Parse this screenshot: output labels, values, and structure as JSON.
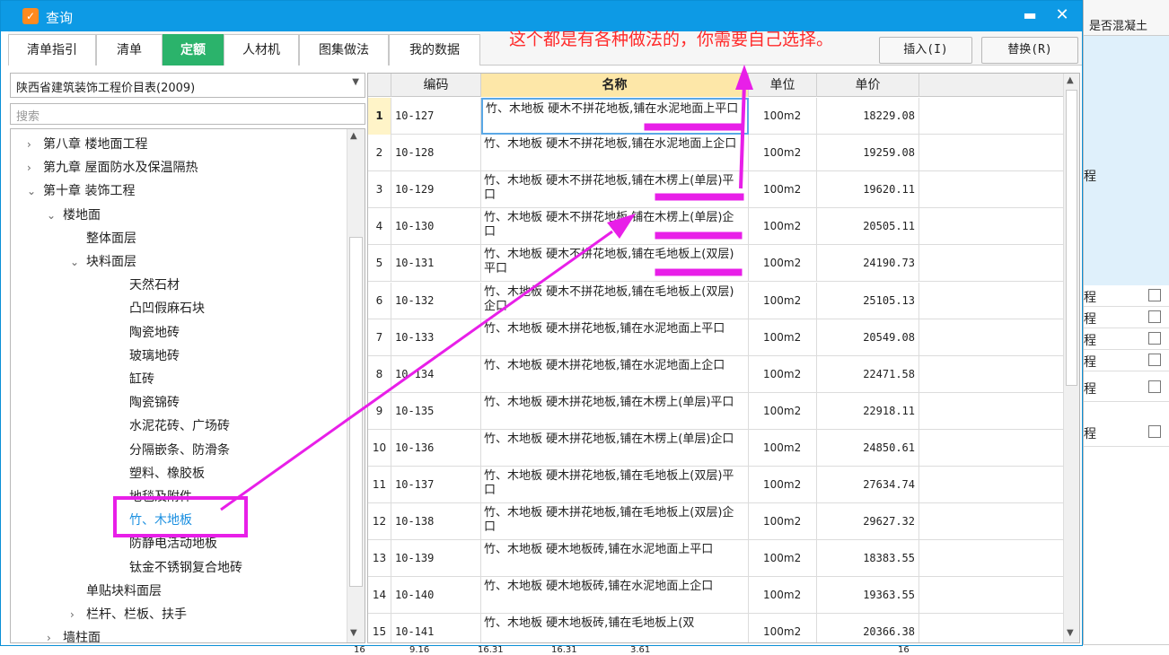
{
  "background": {
    "right_header": "是否混凝土",
    "right_label": "程",
    "rows": [
      "程",
      "程",
      "程",
      "程",
      "程",
      "程"
    ],
    "bottom_numbers": [
      "16",
      "9.16",
      "16.31",
      "16.31",
      "3.61",
      "16"
    ]
  },
  "dialog": {
    "title": "查询",
    "icon": "app-logo-icon",
    "minimize_label": "▬",
    "close_label": "✕"
  },
  "tabs": [
    {
      "label": "清单指引"
    },
    {
      "label": "清单"
    },
    {
      "label": "定额",
      "active": true
    },
    {
      "label": "人材机"
    },
    {
      "label": "图集做法"
    },
    {
      "label": "我的数据"
    }
  ],
  "annotation_text": "这个都是有各种做法的，你需要自己选择。",
  "actions": {
    "insert_label": "插入(I)",
    "replace_label": "替换(R)"
  },
  "library": {
    "selected": "陕西省建筑装饰工程价目表(2009)",
    "search_placeholder": "搜索"
  },
  "tree": [
    {
      "label": "第八章 楼地面工程",
      "chev": "›",
      "level": 1
    },
    {
      "label": "第九章 屋面防水及保温隔热",
      "chev": "›",
      "level": 1
    },
    {
      "label": "第十章 装饰工程",
      "chev": "⌄",
      "level": 1
    },
    {
      "label": "楼地面",
      "chev": "⌄",
      "level": 2
    },
    {
      "label": "整体面层",
      "chev": "",
      "level": 3
    },
    {
      "label": "块料面层",
      "chev": "⌄",
      "level": 3
    },
    {
      "label": "天然石材",
      "chev": "",
      "level": 4
    },
    {
      "label": "凸凹假麻石块",
      "chev": "",
      "level": 4
    },
    {
      "label": "陶瓷地砖",
      "chev": "",
      "level": 4
    },
    {
      "label": "玻璃地砖",
      "chev": "",
      "level": 4
    },
    {
      "label": "缸砖",
      "chev": "",
      "level": 4
    },
    {
      "label": "陶瓷锦砖",
      "chev": "",
      "level": 4
    },
    {
      "label": "水泥花砖、广场砖",
      "chev": "",
      "level": 4
    },
    {
      "label": "分隔嵌条、防滑条",
      "chev": "",
      "level": 4
    },
    {
      "label": "塑料、橡胶板",
      "chev": "",
      "level": 4
    },
    {
      "label": "地毯及附件",
      "chev": "",
      "level": 4
    },
    {
      "label": "竹、木地板",
      "chev": "",
      "level": 4,
      "selected": true
    },
    {
      "label": "防静电活动地板",
      "chev": "",
      "level": 4
    },
    {
      "label": "钛金不锈钢复合地砖",
      "chev": "",
      "level": 4
    },
    {
      "label": "单贴块料面层",
      "chev": "",
      "level": 3
    },
    {
      "label": "栏杆、栏板、扶手",
      "chev": "›",
      "level": 3
    },
    {
      "label": "墙柱面",
      "chev": "›",
      "level": 2
    }
  ],
  "grid": {
    "headers": {
      "code": "编码",
      "name": "名称",
      "unit": "单位",
      "price": "单价"
    },
    "rows": [
      {
        "idx": "1",
        "code": "10-127",
        "name": "竹、木地板 硬木不拼花地板,铺在水泥地面上平口",
        "unit": "100m2",
        "price": "18229.08"
      },
      {
        "idx": "2",
        "code": "10-128",
        "name": "竹、木地板 硬木不拼花地板,铺在水泥地面上企口",
        "unit": "100m2",
        "price": "19259.08"
      },
      {
        "idx": "3",
        "code": "10-129",
        "name": "竹、木地板 硬木不拼花地板,铺在木楞上(单层)平口",
        "unit": "100m2",
        "price": "19620.11"
      },
      {
        "idx": "4",
        "code": "10-130",
        "name": "竹、木地板 硬木不拼花地板,铺在木楞上(单层)企口",
        "unit": "100m2",
        "price": "20505.11"
      },
      {
        "idx": "5",
        "code": "10-131",
        "name": "竹、木地板 硬木不拼花地板,铺在毛地板上(双层)平口",
        "unit": "100m2",
        "price": "24190.73"
      },
      {
        "idx": "6",
        "code": "10-132",
        "name": "竹、木地板 硬木不拼花地板,铺在毛地板上(双层)企口",
        "unit": "100m2",
        "price": "25105.13"
      },
      {
        "idx": "7",
        "code": "10-133",
        "name": "竹、木地板 硬木拼花地板,铺在水泥地面上平口",
        "unit": "100m2",
        "price": "20549.08"
      },
      {
        "idx": "8",
        "code": "10-134",
        "name": "竹、木地板 硬木拼花地板,铺在水泥地面上企口",
        "unit": "100m2",
        "price": "22471.58"
      },
      {
        "idx": "9",
        "code": "10-135",
        "name": "竹、木地板 硬木拼花地板,铺在木楞上(单层)平口",
        "unit": "100m2",
        "price": "22918.11"
      },
      {
        "idx": "10",
        "code": "10-136",
        "name": "竹、木地板 硬木拼花地板,铺在木楞上(单层)企口",
        "unit": "100m2",
        "price": "24850.61"
      },
      {
        "idx": "11",
        "code": "10-137",
        "name": "竹、木地板 硬木拼花地板,铺在毛地板上(双层)平口",
        "unit": "100m2",
        "price": "27634.74"
      },
      {
        "idx": "12",
        "code": "10-138",
        "name": "竹、木地板 硬木拼花地板,铺在毛地板上(双层)企口",
        "unit": "100m2",
        "price": "29627.32"
      },
      {
        "idx": "13",
        "code": "10-139",
        "name": "竹、木地板 硬木地板砖,铺在水泥地面上平口",
        "unit": "100m2",
        "price": "18383.55"
      },
      {
        "idx": "14",
        "code": "10-140",
        "name": "竹、木地板 硬木地板砖,铺在水泥地面上企口",
        "unit": "100m2",
        "price": "19363.55"
      },
      {
        "idx": "15",
        "code": "10-141",
        "name": "竹、木地板 硬木地板砖,铺在毛地板上(双",
        "unit": "100m2",
        "price": "20366.38"
      }
    ]
  },
  "colors": {
    "titlebar": "#0d9ae5",
    "active_tab": "#2bb36b",
    "annotation": "#ff2a2a",
    "highlight": "#e81fe8",
    "header_name": "#fde7a8"
  }
}
